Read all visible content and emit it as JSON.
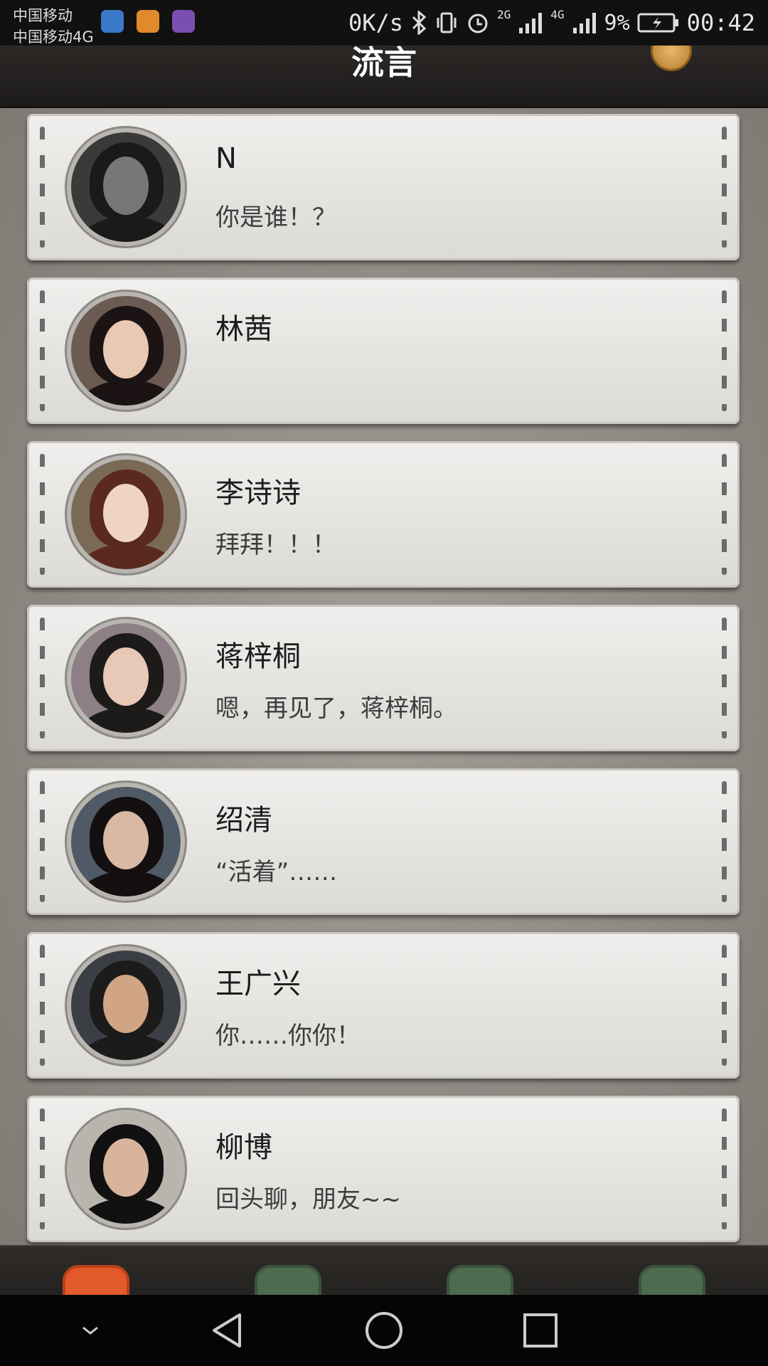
{
  "status_bar": {
    "carrier_1": "中国移动",
    "carrier_2": "中国移动4G",
    "net_speed": "0K/s",
    "signal_2g": "2G",
    "signal_4g": "4G",
    "battery": "9%",
    "time": "00:42",
    "icons": [
      "bluetooth-icon",
      "vibrate-icon",
      "alarm-icon",
      "signal-icon",
      "battery-charging-icon"
    ]
  },
  "header": {
    "title": "流言"
  },
  "conversations": [
    {
      "name": "N",
      "message": "你是谁！？",
      "avatar_tone": "#3a3a3a",
      "hair": "#1a1a1a",
      "face": "#777"
    },
    {
      "name": "林茜",
      "message": "",
      "avatar_tone": "#6b5b53",
      "hair": "#1c1414",
      "face": "#e9c8b4"
    },
    {
      "name": "李诗诗",
      "message": "拜拜！！！",
      "avatar_tone": "#7a6a55",
      "hair": "#5b2a1e",
      "face": "#f0d4c2"
    },
    {
      "name": "蒋梓桐",
      "message": "嗯，再见了，蒋梓桐。",
      "avatar_tone": "#8d7f86",
      "hair": "#1d1a1a",
      "face": "#e8c8b7"
    },
    {
      "name": "绍清",
      "message": "“活着”……",
      "avatar_tone": "#4f5a66",
      "hair": "#140f10",
      "face": "#d9b9a4"
    },
    {
      "name": "王广兴",
      "message": "你……你你！",
      "avatar_tone": "#3b3e44",
      "hair": "#1b1b1b",
      "face": "#d0a484"
    },
    {
      "name": "柳博",
      "message": "回头聊，朋友~~",
      "avatar_tone": "#b9b5ad",
      "hair": "#111",
      "face": "#d7b49b"
    }
  ],
  "tabs": [
    "messages-tab",
    "posts-tab",
    "chat-tab",
    "settings-tab"
  ]
}
